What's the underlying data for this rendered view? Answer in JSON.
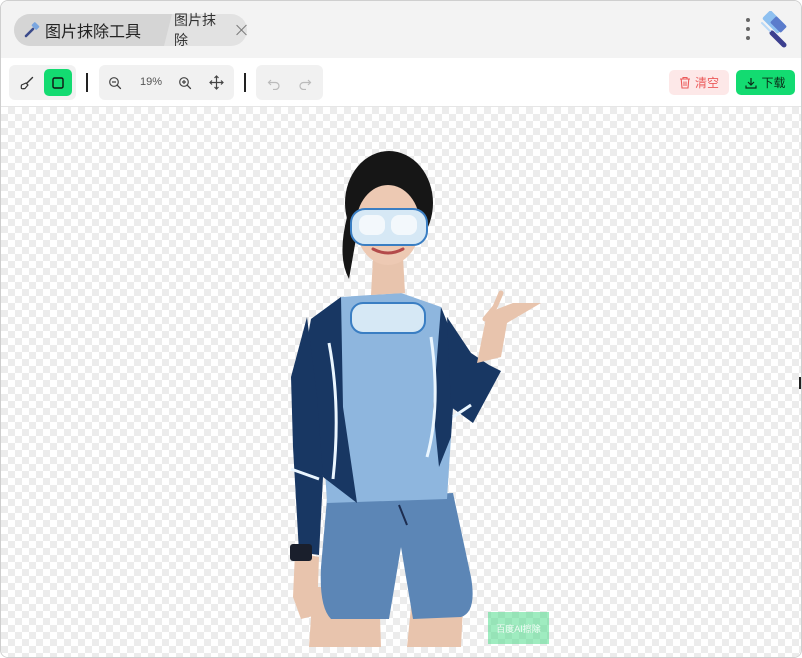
{
  "window": {
    "tab_main_title": "图片抹除工具",
    "tab_secondary_title": "图片抹除"
  },
  "toolbar": {
    "zoom_level": "19%",
    "clear_label": "清空",
    "download_label": "下载"
  },
  "canvas": {
    "watermark_text": "百度AI擦除"
  },
  "icons": {
    "app": "hammer-icon",
    "brush": "brush-icon",
    "rect": "rectangle-select-icon",
    "zoom_out": "zoom-out-icon",
    "zoom_in": "zoom-in-icon",
    "move": "move-icon",
    "undo": "undo-icon",
    "redo": "redo-icon",
    "trash": "trash-icon",
    "download": "download-icon",
    "more": "more-vertical-icon"
  },
  "colors": {
    "accent": "#13db71",
    "danger": "#ec5a5a",
    "danger_bg": "#fde8e8"
  }
}
